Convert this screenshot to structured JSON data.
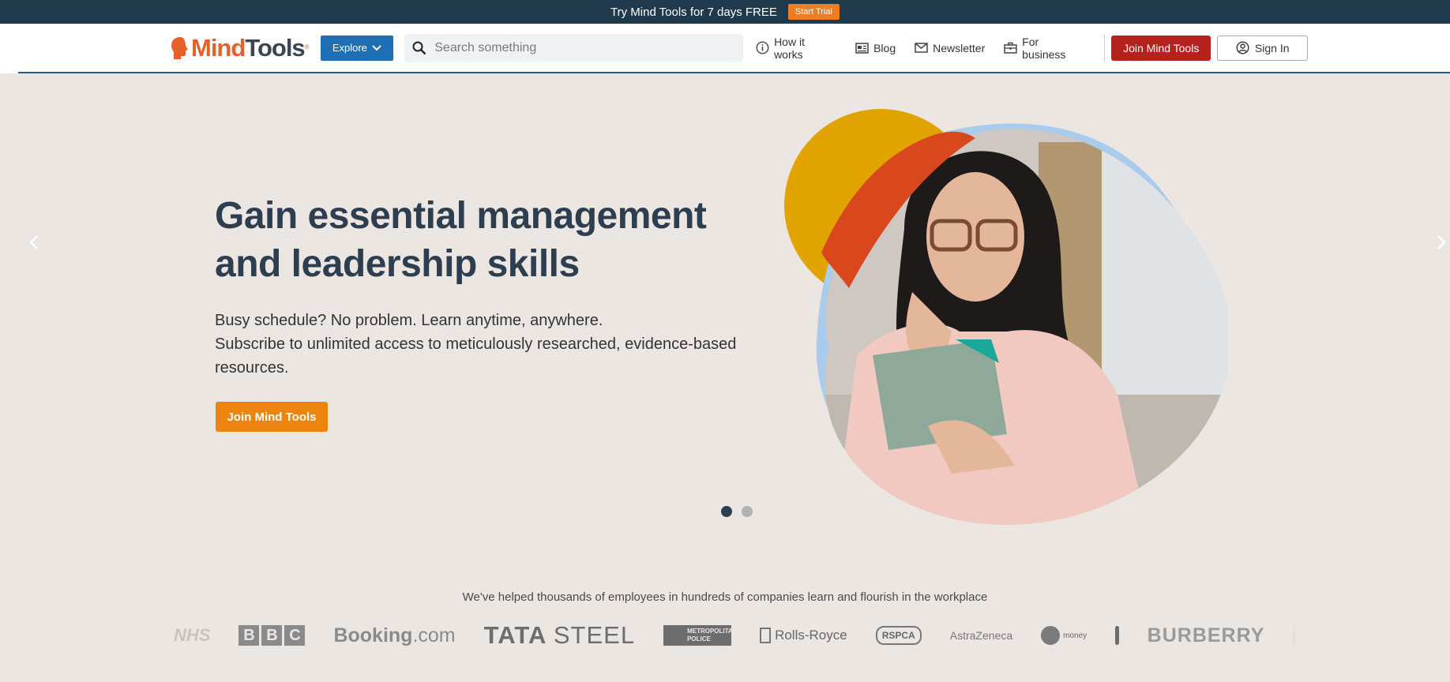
{
  "promo": {
    "text": "Try Mind Tools for 7 days FREE",
    "cta": "Start Trial"
  },
  "header": {
    "logo": {
      "mind": "Mind",
      "tools": "Tools",
      "reg": "®"
    },
    "explore": "Explore",
    "search_placeholder": "Search something",
    "nav": [
      {
        "label": "How it works",
        "icon": "info-icon"
      },
      {
        "label": "Blog",
        "icon": "blog-icon"
      },
      {
        "label": "Newsletter",
        "icon": "envelope-icon"
      },
      {
        "label": "For business",
        "icon": "briefcase-icon"
      }
    ],
    "join": "Join Mind Tools",
    "signin": "Sign In"
  },
  "hero": {
    "title": "Gain essential management and leadership skills",
    "subtitle_line1": "Busy schedule? No problem. Learn anytime, anywhere.",
    "subtitle_line2": "Subscribe to unlimited access to meticulously researched, evidence-based resources.",
    "cta": "Join Mind Tools",
    "slides_total": 2,
    "slide_active": 1
  },
  "clients": {
    "caption": "We've helped thousands of employees in hundreds of companies learn and flourish in the workplace",
    "logos": {
      "nhs": "NHS",
      "bbc": [
        "B",
        "B",
        "C"
      ],
      "booking_a": "Booking",
      "booking_b": ".com",
      "tata_a": "TATA",
      "tata_b": "STEEL",
      "met_line1": "METROPOLITAN",
      "met_line2": "POLICE",
      "rolls": "Rolls-Royce",
      "rspca": "RSPCA",
      "astra": "AstraZeneca",
      "virgin": "money",
      "burberry": "BURBERRY"
    }
  },
  "colors": {
    "promo_bg": "#1f3a4d",
    "accent_orange": "#ee8410",
    "join_red": "#b5221d",
    "explore_blue": "#1e6fb3",
    "heading": "#2c3e50",
    "page_bg": "#ece6e2"
  }
}
